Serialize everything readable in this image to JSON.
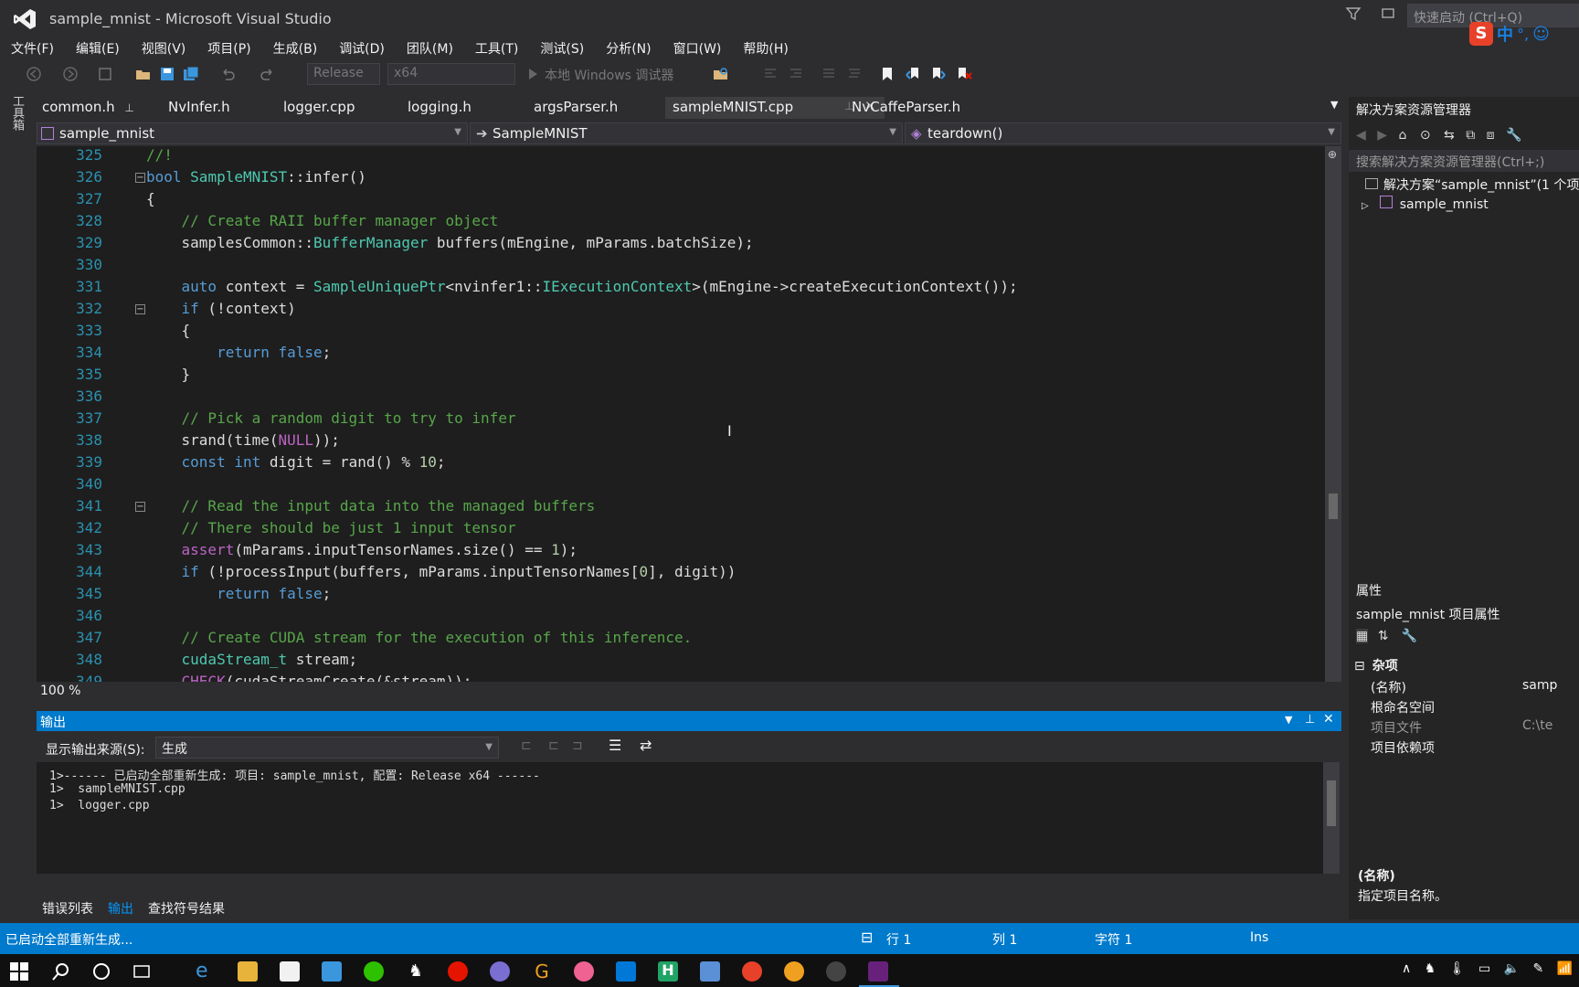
{
  "window": {
    "title": "sample_mnist - Microsoft Visual Studio",
    "quick_launch_placeholder": "快速启动 (Ctrl+Q)",
    "ime_label": "中"
  },
  "menu": [
    "文件(F)",
    "编辑(E)",
    "视图(V)",
    "项目(P)",
    "生成(B)",
    "调试(D)",
    "团队(M)",
    "工具(T)",
    "测试(S)",
    "分析(N)",
    "窗口(W)",
    "帮助(H)"
  ],
  "toolbar": {
    "config": "Release",
    "platform": "x64",
    "debugger": "本地 Windows 调试器"
  },
  "toolbox_label": "工具箱",
  "tabs": [
    {
      "label": "common.h",
      "active": false
    },
    {
      "label": "NvInfer.h",
      "active": false
    },
    {
      "label": "logger.cpp",
      "active": false
    },
    {
      "label": "logging.h",
      "active": false
    },
    {
      "label": "argsParser.h",
      "active": false
    },
    {
      "label": "sampleMNIST.cpp",
      "active": true
    },
    {
      "label": "NvCaffeParser.h",
      "active": false
    }
  ],
  "nav": {
    "project": "sample_mnist",
    "class": "SampleMNIST",
    "member": "teardown()"
  },
  "code_lines": [
    {
      "n": "325",
      "t": "//!"
    },
    {
      "n": "326",
      "t": "bool SampleMNIST::infer()"
    },
    {
      "n": "327",
      "t": "{"
    },
    {
      "n": "328",
      "t": "    // Create RAII buffer manager object"
    },
    {
      "n": "329",
      "t": "    samplesCommon::BufferManager buffers(mEngine, mParams.batchSize);"
    },
    {
      "n": "330",
      "t": ""
    },
    {
      "n": "331",
      "t": "    auto context = SampleUniquePtr<nvinfer1::IExecutionContext>(mEngine->createExecutionContext());"
    },
    {
      "n": "332",
      "t": "    if (!context)"
    },
    {
      "n": "333",
      "t": "    {"
    },
    {
      "n": "334",
      "t": "        return false;"
    },
    {
      "n": "335",
      "t": "    }"
    },
    {
      "n": "336",
      "t": ""
    },
    {
      "n": "337",
      "t": "    // Pick a random digit to try to infer"
    },
    {
      "n": "338",
      "t": "    srand(time(NULL));"
    },
    {
      "n": "339",
      "t": "    const int digit = rand() % 10;"
    },
    {
      "n": "340",
      "t": ""
    },
    {
      "n": "341",
      "t": "    // Read the input data into the managed buffers"
    },
    {
      "n": "342",
      "t": "    // There should be just 1 input tensor"
    },
    {
      "n": "343",
      "t": "    assert(mParams.inputTensorNames.size() == 1);"
    },
    {
      "n": "344",
      "t": "    if (!processInput(buffers, mParams.inputTensorNames[0], digit))"
    },
    {
      "n": "345",
      "t": "        return false;"
    },
    {
      "n": "346",
      "t": ""
    },
    {
      "n": "347",
      "t": "    // Create CUDA stream for the execution of this inference."
    },
    {
      "n": "348",
      "t": "    cudaStream_t stream;"
    },
    {
      "n": "349",
      "t": "    CHECK(cudaStreamCreate(&stream));"
    }
  ],
  "zoom": "100 %",
  "output": {
    "title": "输出",
    "source_label": "显示输出来源(S):",
    "source_value": "生成",
    "lines": [
      "1>------ 已启动全部重新生成: 项目: sample_mnist, 配置: Release x64 ------",
      "1>  sampleMNIST.cpp",
      "1>  logger.cpp"
    ]
  },
  "bottom_tabs": [
    {
      "label": "错误列表",
      "active": false
    },
    {
      "label": "输出",
      "active": true
    },
    {
      "label": "查找符号结果",
      "active": false
    }
  ],
  "solution_explorer": {
    "title": "解决方案资源管理器",
    "search_placeholder": "搜索解决方案资源管理器(Ctrl+;)",
    "solution_node": "解决方案“sample_mnist”(1 个项",
    "project_node": "sample_mnist"
  },
  "properties": {
    "title": "属性",
    "subject": "sample_mnist 项目属性",
    "category": "杂项",
    "rows": [
      {
        "name": "(名称)",
        "value": "samp"
      },
      {
        "name": "根命名空间",
        "value": ""
      },
      {
        "name": "项目文件",
        "value": "C:\\te"
      },
      {
        "name": "项目依赖项",
        "value": ""
      }
    ],
    "desc_title": "(名称)",
    "desc_text": "指定项目名称。"
  },
  "status": {
    "message": "已启动全部重新生成...",
    "line": "行 1",
    "col": "列 1",
    "char": "字符 1",
    "mode": "Ins"
  }
}
